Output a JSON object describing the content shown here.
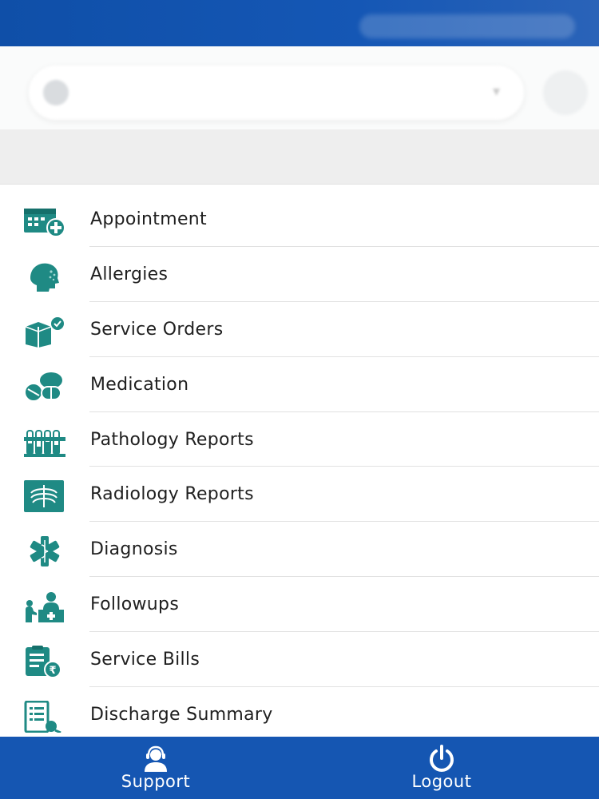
{
  "menu": {
    "items": [
      {
        "label": "Appointment",
        "icon": "calendar-plus-icon"
      },
      {
        "label": "Allergies",
        "icon": "head-allergy-icon"
      },
      {
        "label": "Service Orders",
        "icon": "package-check-icon"
      },
      {
        "label": "Medication",
        "icon": "pills-icon"
      },
      {
        "label": "Pathology Reports",
        "icon": "test-tubes-icon"
      },
      {
        "label": "Radiology Reports",
        "icon": "xray-icon"
      },
      {
        "label": "Diagnosis",
        "icon": "medical-star-icon"
      },
      {
        "label": "Followups",
        "icon": "doctor-desk-icon"
      },
      {
        "label": "Service Bills",
        "icon": "rupee-bill-icon"
      },
      {
        "label": "Discharge Summary",
        "icon": "document-list-icon"
      }
    ]
  },
  "bottom_nav": {
    "support_label": "Support",
    "logout_label": "Logout"
  },
  "colors": {
    "brand_blue": "#1556b2",
    "icon_teal": "#1f8a84"
  }
}
